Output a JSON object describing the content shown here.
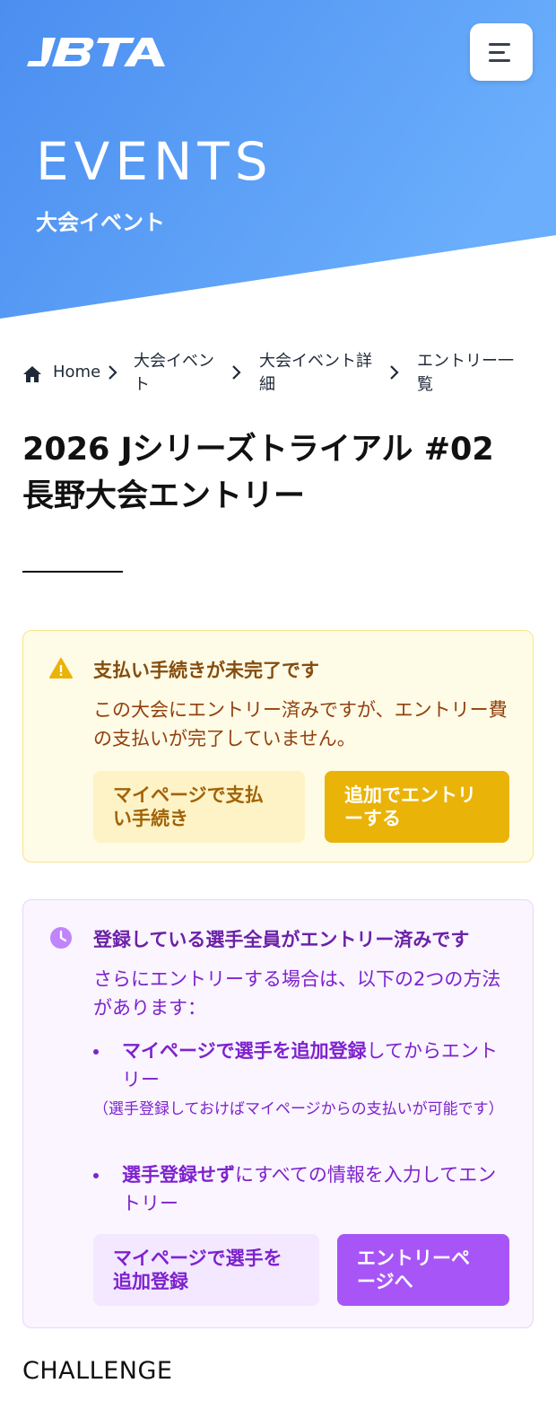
{
  "header": {
    "logo_text": "JBTA",
    "menu_icon": "hamburger-menu-icon",
    "title": "EVENTS",
    "subtitle": "大会イベント"
  },
  "breadcrumb": {
    "home": "Home",
    "item1": "大会イベント",
    "item1_line1": "大会イベン",
    "item1_line2": "ト",
    "item2_line1": "大会イベント詳",
    "item2_line2": "細",
    "item3_line1": "エントリー一",
    "item3_line2": "覧"
  },
  "page": {
    "title_line1": "2026 Jシリーズトライアル #02",
    "title_line2": "長野大会エントリー"
  },
  "payment_alert": {
    "icon": "warning-icon",
    "title": "支払い手続きが未完了です",
    "text": "この大会にエントリー済みですが、エントリー費の支払いが完了していません。",
    "btn_mypage_line1": "マイページで支払",
    "btn_mypage_line2": "い手続き",
    "btn_add_line1": "追加でエントリ",
    "btn_add_line2": "ーする",
    "colors": {
      "background": "#fefbe6",
      "border": "#fbe38a",
      "accent": "#eab308"
    }
  },
  "entry_info": {
    "icon": "clock-icon",
    "title": "登録している選手全員がエントリー済みです",
    "text": "さらにエントリーする場合は、以下の2つの方法があります：",
    "bullet1_strong": "マイページで選手を追加登録",
    "bullet1_rest": "してからエントリー",
    "bullet1_note": "（選手登録しておけばマイページからの支払いが可能です）",
    "bullet2_strong": "選手登録せず",
    "bullet2_rest": "にすべての情報を入力してエントリー",
    "btn_register_line1": "マイページで選手を",
    "btn_register_line2": "追加登録",
    "btn_entry_line1": "エントリーペ",
    "btn_entry_line2": "ージへ",
    "colors": {
      "background": "#faf5ff",
      "border": "#e9d5ff",
      "accent": "#a855f7"
    }
  },
  "section": {
    "next_heading": "CHALLENGE"
  }
}
